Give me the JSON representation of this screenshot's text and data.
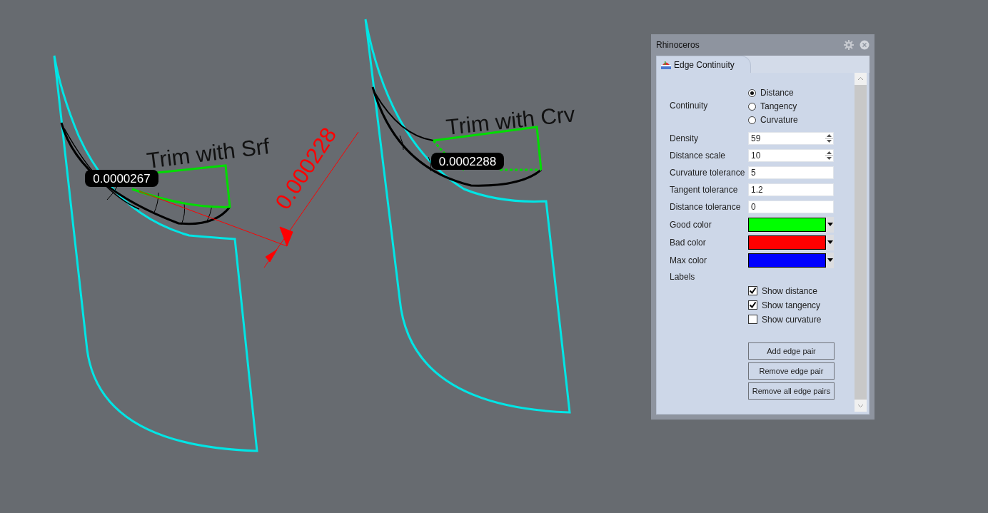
{
  "viewport": {
    "annotations": [
      {
        "kind": "note",
        "text": "Trim with Srf"
      },
      {
        "kind": "note",
        "text": "Trim with Crv"
      },
      {
        "kind": "tag",
        "text": "0.0000267"
      },
      {
        "kind": "tag",
        "text": "0.0002288"
      },
      {
        "kind": "dimension",
        "text": "0.000228"
      }
    ]
  },
  "panel": {
    "title": "Rhinoceros",
    "tab": {
      "label": "Edge Continuity",
      "selected": true
    },
    "continuity": {
      "label": "Continuity",
      "options": [
        {
          "label": "Distance",
          "selected": true
        },
        {
          "label": "Tangency",
          "selected": false
        },
        {
          "label": "Curvature",
          "selected": false
        }
      ]
    },
    "fields": [
      {
        "label": "Density",
        "value": "59",
        "kind": "spin"
      },
      {
        "label": "Distance scale",
        "value": "10",
        "kind": "spin"
      },
      {
        "label": "Curvature tolerance",
        "value": "5",
        "kind": "text"
      },
      {
        "label": "Tangent tolerance",
        "value": "1.2",
        "kind": "text"
      },
      {
        "label": "Distance tolerance",
        "value": "0",
        "kind": "text"
      }
    ],
    "colors": [
      {
        "label": "Good color",
        "color": "#00ff00"
      },
      {
        "label": "Bad color",
        "color": "#ff0000"
      },
      {
        "label": "Max color",
        "color": "#0000ff"
      }
    ],
    "labels": {
      "label": "Labels",
      "checks": [
        {
          "label": "Show distance",
          "checked": true
        },
        {
          "label": "Show tangency",
          "checked": true
        },
        {
          "label": "Show curvature",
          "checked": false
        }
      ]
    },
    "buttons": [
      "Add edge pair",
      "Remove edge pair",
      "Remove all edge pairs"
    ]
  }
}
